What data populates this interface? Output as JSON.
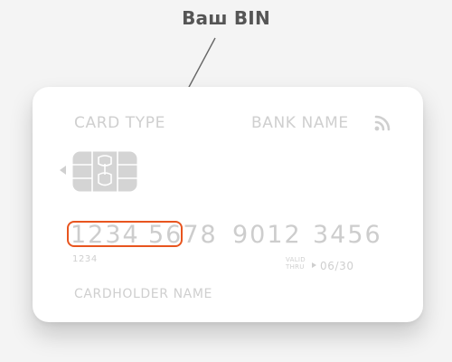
{
  "caption": "Ваш BIN",
  "card": {
    "card_type": "CARD TYPE",
    "bank_name": "BANK NAME",
    "number_groups": [
      "1234",
      "5678",
      "9012",
      "3456"
    ],
    "small_number": "1234",
    "valid_thru_line1": "VALID",
    "valid_thru_line2": "THRU",
    "expiry": "06/30",
    "cardholder": "CARDHOLDER NAME"
  },
  "icons": {
    "contactless": "contactless-icon",
    "chip": "chip-icon"
  },
  "colors": {
    "highlight": "#e8551f",
    "card_text": "#cfcfcf",
    "caption": "#555555",
    "pointer_line": "#666666"
  }
}
